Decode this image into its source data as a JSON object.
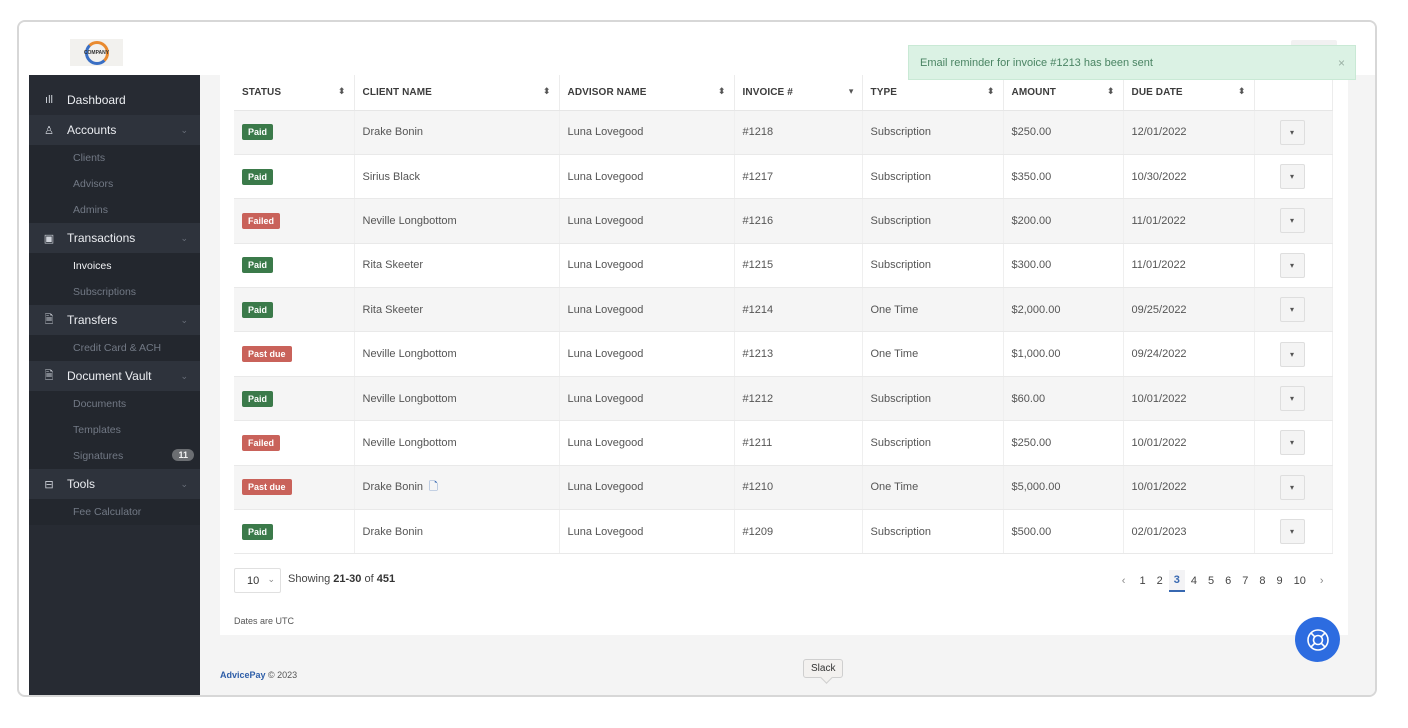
{
  "logo": {
    "text": "COMPANY"
  },
  "sidebar": {
    "items": [
      {
        "label": "Dashboard",
        "icon": "bar-chart-icon",
        "type": "section-first"
      },
      {
        "label": "Accounts",
        "icon": "user-icon",
        "type": "section",
        "chevron": true
      },
      {
        "label": "Clients",
        "type": "sub"
      },
      {
        "label": "Advisors",
        "type": "sub"
      },
      {
        "label": "Admins",
        "type": "sub"
      },
      {
        "label": "Transactions",
        "icon": "money-icon",
        "type": "section",
        "chevron": true
      },
      {
        "label": "Invoices",
        "type": "sub",
        "active": true
      },
      {
        "label": "Subscriptions",
        "type": "sub"
      },
      {
        "label": "Transfers",
        "icon": "document-icon",
        "type": "section",
        "chevron": true
      },
      {
        "label": "Credit Card & ACH",
        "type": "sub"
      },
      {
        "label": "Document Vault",
        "icon": "document-icon",
        "type": "section",
        "chevron": true
      },
      {
        "label": "Documents",
        "type": "sub"
      },
      {
        "label": "Templates",
        "type": "sub"
      },
      {
        "label": "Signatures",
        "type": "sub",
        "badge": "11"
      },
      {
        "label": "Tools",
        "icon": "briefcase-icon",
        "type": "section",
        "chevron": true
      },
      {
        "label": "Fee Calculator",
        "type": "sub"
      }
    ]
  },
  "toast": {
    "message": "Email reminder for invoice #1213 has been sent",
    "close": "×"
  },
  "table": {
    "columns": [
      {
        "label": "STATUS",
        "sort": "⬍"
      },
      {
        "label": "CLIENT NAME",
        "sort": "⬍"
      },
      {
        "label": "ADVISOR NAME",
        "sort": "⬍"
      },
      {
        "label": "INVOICE #",
        "sort": "▾"
      },
      {
        "label": "TYPE",
        "sort": "⬍"
      },
      {
        "label": "AMOUNT",
        "sort": "⬍"
      },
      {
        "label": "DUE DATE",
        "sort": "⬍"
      },
      {
        "label": "",
        "sort": ""
      }
    ],
    "rows": [
      {
        "status": "Paid",
        "client": "Drake Bonin",
        "advisor": "Luna Lovegood",
        "invoice": "#1218",
        "type": "Subscription",
        "amount": "$250.00",
        "due": "12/01/2022",
        "doc": false
      },
      {
        "status": "Paid",
        "client": "Sirius Black",
        "advisor": "Luna Lovegood",
        "invoice": "#1217",
        "type": "Subscription",
        "amount": "$350.00",
        "due": "10/30/2022",
        "doc": false
      },
      {
        "status": "Failed",
        "client": "Neville Longbottom",
        "advisor": "Luna Lovegood",
        "invoice": "#1216",
        "type": "Subscription",
        "amount": "$200.00",
        "due": "11/01/2022",
        "doc": false
      },
      {
        "status": "Paid",
        "client": "Rita Skeeter",
        "advisor": "Luna Lovegood",
        "invoice": "#1215",
        "type": "Subscription",
        "amount": "$300.00",
        "due": "11/01/2022",
        "doc": false
      },
      {
        "status": "Paid",
        "client": "Rita Skeeter",
        "advisor": "Luna Lovegood",
        "invoice": "#1214",
        "type": "One Time",
        "amount": "$2,000.00",
        "due": "09/25/2022",
        "doc": false
      },
      {
        "status": "Past due",
        "client": "Neville Longbottom",
        "advisor": "Luna Lovegood",
        "invoice": "#1213",
        "type": "One Time",
        "amount": "$1,000.00",
        "due": "09/24/2022",
        "doc": false
      },
      {
        "status": "Paid",
        "client": "Neville Longbottom",
        "advisor": "Luna Lovegood",
        "invoice": "#1212",
        "type": "Subscription",
        "amount": "$60.00",
        "due": "10/01/2022",
        "doc": false
      },
      {
        "status": "Failed",
        "client": "Neville Longbottom",
        "advisor": "Luna Lovegood",
        "invoice": "#1211",
        "type": "Subscription",
        "amount": "$250.00",
        "due": "10/01/2022",
        "doc": false
      },
      {
        "status": "Past due",
        "client": "Drake Bonin",
        "advisor": "Luna Lovegood",
        "invoice": "#1210",
        "type": "One Time",
        "amount": "$5,000.00",
        "due": "10/01/2022",
        "doc": true
      },
      {
        "status": "Paid",
        "client": "Drake Bonin",
        "advisor": "Luna Lovegood",
        "invoice": "#1209",
        "type": "Subscription",
        "amount": "$500.00",
        "due": "02/01/2023",
        "doc": false
      }
    ],
    "action_glyph": "▾"
  },
  "status_colors": {
    "Paid": "#3b7a4a",
    "Failed": "#c9625a",
    "Past due": "#c9625a"
  },
  "pagination": {
    "page_size": "10",
    "showing_prefix": "Showing ",
    "range": "21-30",
    "of_text": " of ",
    "total": "451",
    "prev": "‹",
    "next": "›",
    "pages": [
      "1",
      "2",
      "3",
      "4",
      "5",
      "6",
      "7",
      "8",
      "9",
      "10"
    ],
    "current": "3"
  },
  "dates_note": "Dates are UTC",
  "footer": {
    "brand": "AdvicePay",
    "copyright": " © 2023"
  },
  "tooltip": {
    "text": "Slack"
  },
  "accent_color": "#2d6ce0"
}
